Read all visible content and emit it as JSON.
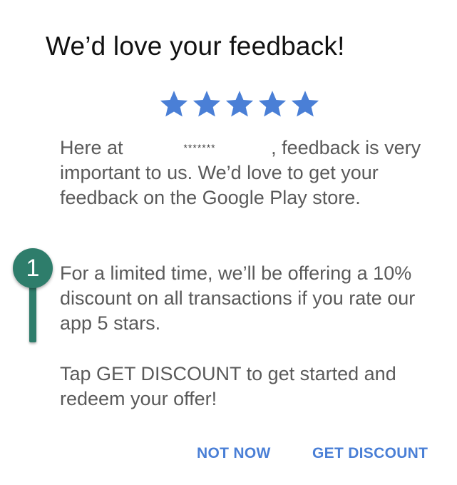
{
  "dialog": {
    "title": "We’d love your feedback!",
    "rating": {
      "stars": 5,
      "max": 5,
      "color": "#4a7fd6"
    },
    "paragraph1": {
      "prefix": "Here at",
      "redacted": "*******",
      "suffix": ", feedback is very important to us. We’d love to get your feedback on the Google Play store."
    },
    "paragraph2": "For a limited time, we’ll be offering a 10% discount on all transactions if you rate our app 5 stars.",
    "paragraph3": "Tap GET DISCOUNT to get started and redeem your offer!",
    "buttons": {
      "not_now": "NOT NOW",
      "get_discount": "GET DISCOUNT"
    }
  },
  "callout": {
    "label": "1",
    "color": "#2e7d6b"
  }
}
